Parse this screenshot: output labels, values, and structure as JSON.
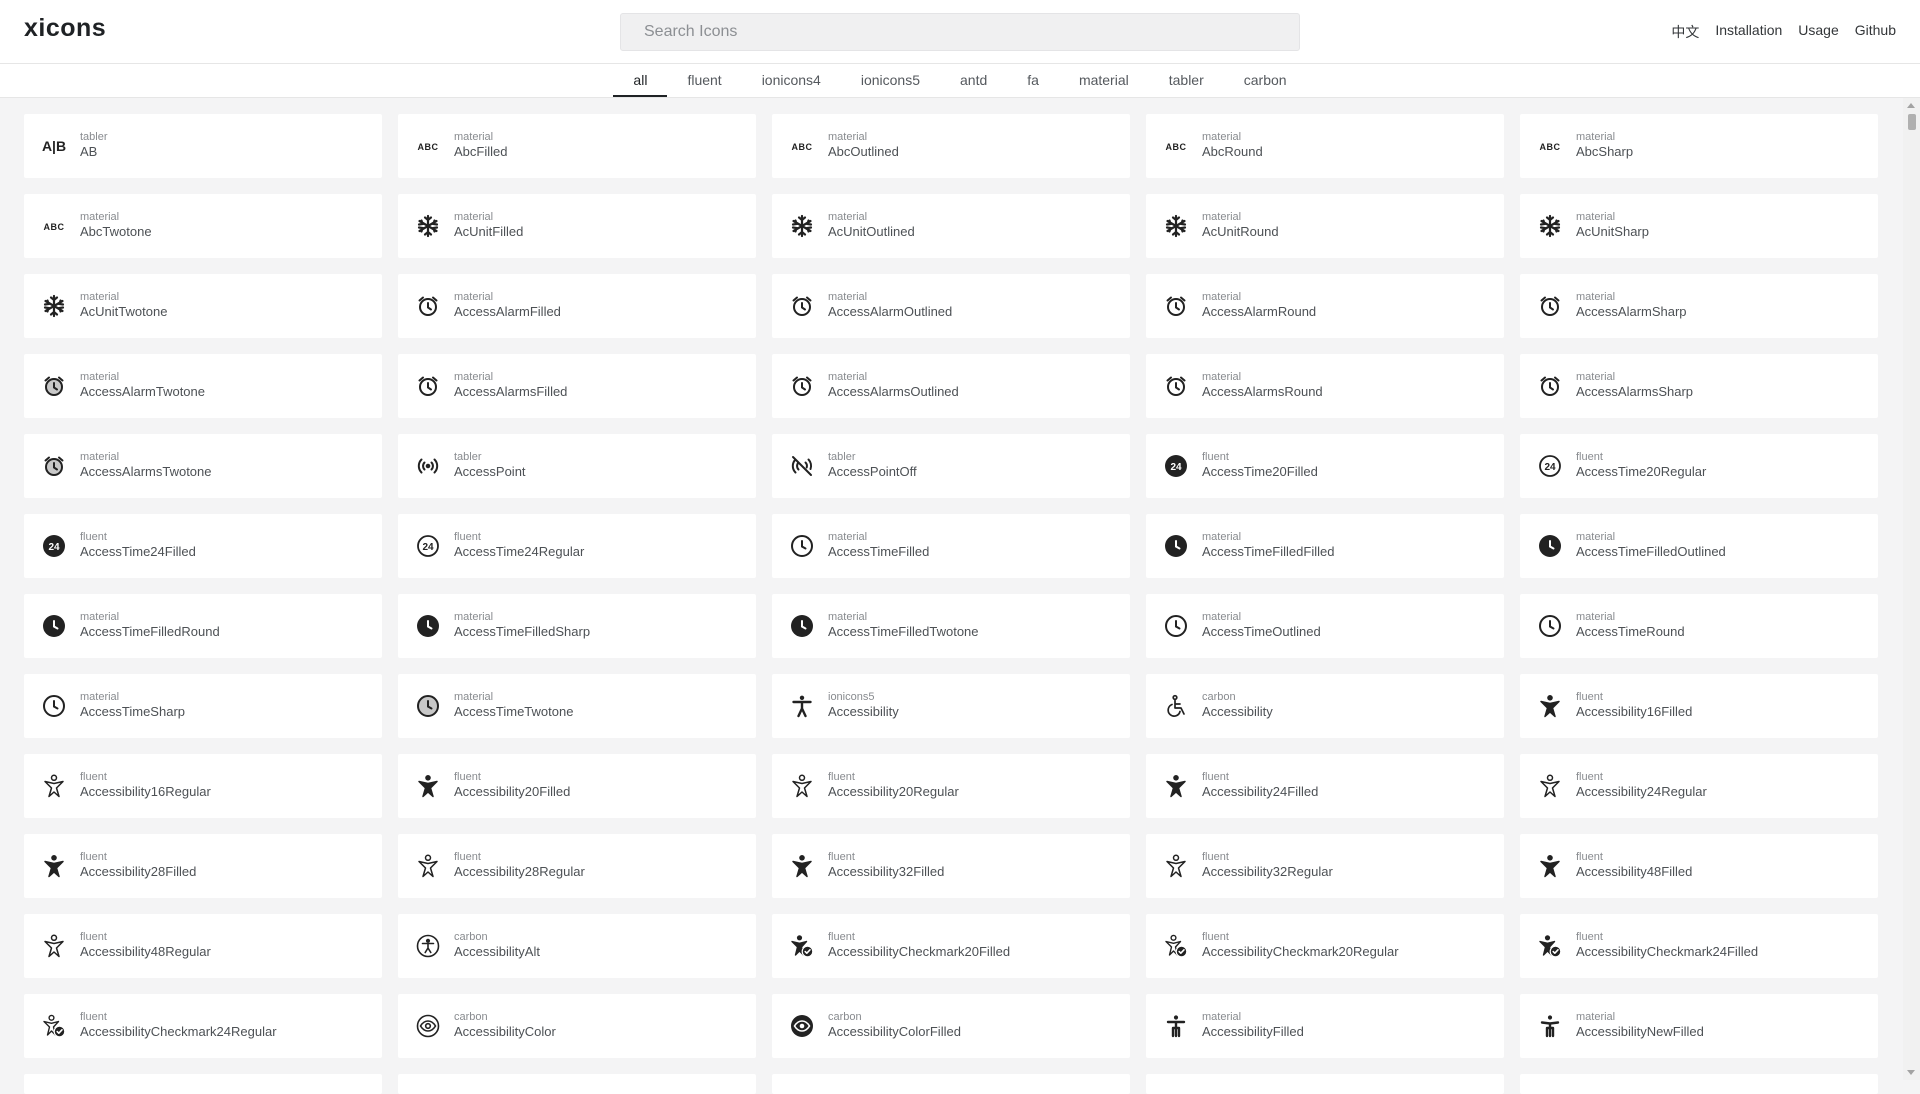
{
  "header": {
    "logo": "xicons",
    "search_placeholder": "Search Icons",
    "links": [
      "中文",
      "Installation",
      "Usage",
      "Github"
    ]
  },
  "tabs": [
    "all",
    "fluent",
    "ionicons4",
    "ionicons5",
    "antd",
    "fa",
    "material",
    "tabler",
    "carbon"
  ],
  "active_tab": "all",
  "icons": [
    {
      "lib": "tabler",
      "name": "AB",
      "icon": "ab-icon"
    },
    {
      "lib": "material",
      "name": "AbcFilled",
      "icon": "abc-icon"
    },
    {
      "lib": "material",
      "name": "AbcOutlined",
      "icon": "abc-icon"
    },
    {
      "lib": "material",
      "name": "AbcRound",
      "icon": "abc-icon"
    },
    {
      "lib": "material",
      "name": "AbcSharp",
      "icon": "abc-icon"
    },
    {
      "lib": "material",
      "name": "AbcTwotone",
      "icon": "abc-icon"
    },
    {
      "lib": "material",
      "name": "AcUnitFilled",
      "icon": "snowflake-icon"
    },
    {
      "lib": "material",
      "name": "AcUnitOutlined",
      "icon": "snowflake-icon"
    },
    {
      "lib": "material",
      "name": "AcUnitRound",
      "icon": "snowflake-icon"
    },
    {
      "lib": "material",
      "name": "AcUnitSharp",
      "icon": "snowflake-icon"
    },
    {
      "lib": "material",
      "name": "AcUnitTwotone",
      "icon": "snowflake-icon"
    },
    {
      "lib": "material",
      "name": "AccessAlarmFilled",
      "icon": "alarm-icon"
    },
    {
      "lib": "material",
      "name": "AccessAlarmOutlined",
      "icon": "alarm-icon"
    },
    {
      "lib": "material",
      "name": "AccessAlarmRound",
      "icon": "alarm-icon"
    },
    {
      "lib": "material",
      "name": "AccessAlarmSharp",
      "icon": "alarm-icon"
    },
    {
      "lib": "material",
      "name": "AccessAlarmTwotone",
      "icon": "alarm-twotone-icon"
    },
    {
      "lib": "material",
      "name": "AccessAlarmsFilled",
      "icon": "alarm-icon"
    },
    {
      "lib": "material",
      "name": "AccessAlarmsOutlined",
      "icon": "alarm-icon"
    },
    {
      "lib": "material",
      "name": "AccessAlarmsRound",
      "icon": "alarm-icon"
    },
    {
      "lib": "material",
      "name": "AccessAlarmsSharp",
      "icon": "alarm-icon"
    },
    {
      "lib": "material",
      "name": "AccessAlarmsTwotone",
      "icon": "alarm-twotone-icon"
    },
    {
      "lib": "tabler",
      "name": "AccessPoint",
      "icon": "access-point-icon"
    },
    {
      "lib": "tabler",
      "name": "AccessPointOff",
      "icon": "access-point-off-icon"
    },
    {
      "lib": "fluent",
      "name": "AccessTime20Filled",
      "icon": "time-24-filled-icon"
    },
    {
      "lib": "fluent",
      "name": "AccessTime20Regular",
      "icon": "time-24-regular-icon"
    },
    {
      "lib": "fluent",
      "name": "AccessTime24Filled",
      "icon": "time-24-filled-icon"
    },
    {
      "lib": "fluent",
      "name": "AccessTime24Regular",
      "icon": "time-24-regular-icon"
    },
    {
      "lib": "material",
      "name": "AccessTimeFilled",
      "icon": "clock-outline-icon"
    },
    {
      "lib": "material",
      "name": "AccessTimeFilledFilled",
      "icon": "clock-filled-icon"
    },
    {
      "lib": "material",
      "name": "AccessTimeFilledOutlined",
      "icon": "clock-filled-icon"
    },
    {
      "lib": "material",
      "name": "AccessTimeFilledRound",
      "icon": "clock-filled-icon"
    },
    {
      "lib": "material",
      "name": "AccessTimeFilledSharp",
      "icon": "clock-filled-icon"
    },
    {
      "lib": "material",
      "name": "AccessTimeFilledTwotone",
      "icon": "clock-filled-icon"
    },
    {
      "lib": "material",
      "name": "AccessTimeOutlined",
      "icon": "clock-outline-icon"
    },
    {
      "lib": "material",
      "name": "AccessTimeRound",
      "icon": "clock-outline-icon"
    },
    {
      "lib": "material",
      "name": "AccessTimeSharp",
      "icon": "clock-outline-icon"
    },
    {
      "lib": "material",
      "name": "AccessTimeTwotone",
      "icon": "clock-twotone-icon"
    },
    {
      "lib": "ionicons5",
      "name": "Accessibility",
      "icon": "accessibility-icon"
    },
    {
      "lib": "carbon",
      "name": "Accessibility",
      "icon": "wheelchair-icon"
    },
    {
      "lib": "fluent",
      "name": "Accessibility16Filled",
      "icon": "person-star-filled-icon"
    },
    {
      "lib": "fluent",
      "name": "Accessibility16Regular",
      "icon": "person-star-regular-icon"
    },
    {
      "lib": "fluent",
      "name": "Accessibility20Filled",
      "icon": "person-star-filled-icon"
    },
    {
      "lib": "fluent",
      "name": "Accessibility20Regular",
      "icon": "person-star-regular-icon"
    },
    {
      "lib": "fluent",
      "name": "Accessibility24Filled",
      "icon": "person-star-filled-icon"
    },
    {
      "lib": "fluent",
      "name": "Accessibility24Regular",
      "icon": "person-star-regular-icon"
    },
    {
      "lib": "fluent",
      "name": "Accessibility28Filled",
      "icon": "person-star-filled-icon"
    },
    {
      "lib": "fluent",
      "name": "Accessibility28Regular",
      "icon": "person-star-regular-icon"
    },
    {
      "lib": "fluent",
      "name": "Accessibility32Filled",
      "icon": "person-star-filled-icon"
    },
    {
      "lib": "fluent",
      "name": "Accessibility32Regular",
      "icon": "person-star-regular-icon"
    },
    {
      "lib": "fluent",
      "name": "Accessibility48Filled",
      "icon": "person-star-filled-icon"
    },
    {
      "lib": "fluent",
      "name": "Accessibility48Regular",
      "icon": "person-star-regular-icon"
    },
    {
      "lib": "carbon",
      "name": "AccessibilityAlt",
      "icon": "accessibility-circle-icon"
    },
    {
      "lib": "fluent",
      "name": "AccessibilityCheckmark20Filled",
      "icon": "person-check-filled-icon"
    },
    {
      "lib": "fluent",
      "name": "AccessibilityCheckmark20Regular",
      "icon": "person-check-regular-icon"
    },
    {
      "lib": "fluent",
      "name": "AccessibilityCheckmark24Filled",
      "icon": "person-check-filled-icon"
    },
    {
      "lib": "fluent",
      "name": "AccessibilityCheckmark24Regular",
      "icon": "person-check-regular-icon"
    },
    {
      "lib": "carbon",
      "name": "AccessibilityColor",
      "icon": "color-eye-icon"
    },
    {
      "lib": "carbon",
      "name": "AccessibilityColorFilled",
      "icon": "color-eye-filled-icon"
    },
    {
      "lib": "material",
      "name": "AccessibilityFilled",
      "icon": "person-standing-icon"
    },
    {
      "lib": "material",
      "name": "AccessibilityNewFilled",
      "icon": "person-arms-up-icon"
    }
  ]
}
